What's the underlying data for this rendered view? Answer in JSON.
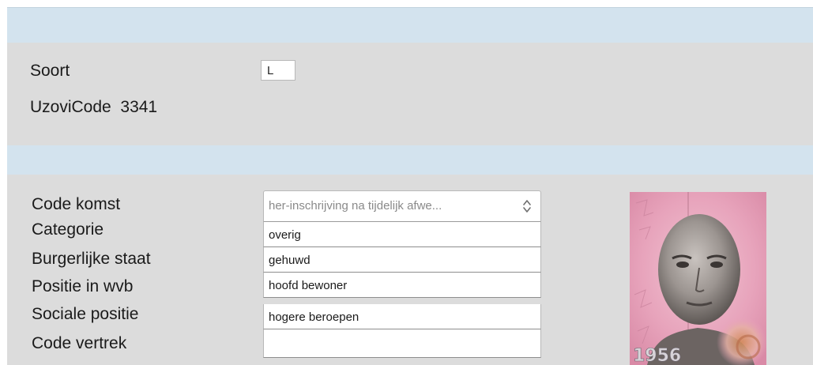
{
  "top_section": {
    "soort_label": "Soort",
    "soort_value": "L",
    "uzovi_label": "UzoviCode",
    "uzovi_value": "3341"
  },
  "details": {
    "code_komst_label": "Code komst",
    "code_komst_value": "her-inschrijving na tijdelijk afwe...",
    "categorie_label": "Categorie",
    "categorie_value": "overig",
    "burgerlijke_staat_label": "Burgerlijke staat",
    "burgerlijke_staat_value": "gehuwd",
    "positie_label": "Positie in wvb",
    "positie_value": "hoofd bewoner",
    "sociale_positie_label": "Sociale positie",
    "sociale_positie_value": "hogere beroepen",
    "code_vertrek_label": "Code vertrek",
    "code_vertrek_value": ""
  },
  "photo": {
    "year_text": "1956"
  },
  "colors": {
    "band": "#d3e3ee",
    "panel": "#dcdcdc",
    "photo_bg": "#e9a7be"
  },
  "icons": {
    "select_chevron": "up-down-chevron-icon"
  }
}
